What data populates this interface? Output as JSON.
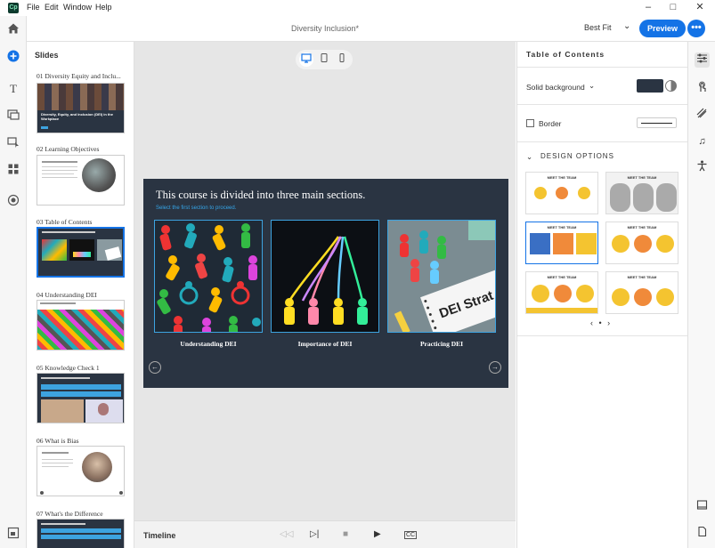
{
  "window": {
    "menus": [
      "File",
      "Edit",
      "Window",
      "Help"
    ],
    "doc_title": "Diversity Inclusion*"
  },
  "toolbar": {
    "fit_label": "Best Fit",
    "preview_label": "Preview",
    "more_label": "•••"
  },
  "slides_panel": {
    "title": "Slides",
    "items": [
      {
        "label": "01  Diversity Equity and Inclu..."
      },
      {
        "label": "02  Learning Objectives"
      },
      {
        "label": "03  Table of Contents"
      },
      {
        "label": "04  Understanding DEI"
      },
      {
        "label": "05  Knowledge Check 1"
      },
      {
        "label": "06  What is Bias"
      },
      {
        "label": "07  What's the Difference"
      }
    ]
  },
  "slide": {
    "title": "This course is divided into three main sections.",
    "subtitle": "Select the first section to proceed.",
    "cards": [
      {
        "label": "Understanding DEI"
      },
      {
        "label": "Importance of DEI"
      },
      {
        "label": "Practicing DEI"
      }
    ],
    "card3_sign": "DEI Strat",
    "thumb1_title": "Diversity, Equity, and Inclusion (DEI) in the Workplace"
  },
  "timeline": {
    "label": "Timeline"
  },
  "properties": {
    "title": "Table of Contents",
    "background_label": "Solid background",
    "background_color": "#2a3442",
    "border_label": "Border",
    "design_options_label": "DESIGN OPTIONS",
    "design_option_heading": "MEET THE TEAM",
    "pager": "‹ • ›"
  },
  "colors": {
    "accent": "#1473e6",
    "slide_bg": "#2a3442",
    "card_border": "#3da3e0"
  }
}
